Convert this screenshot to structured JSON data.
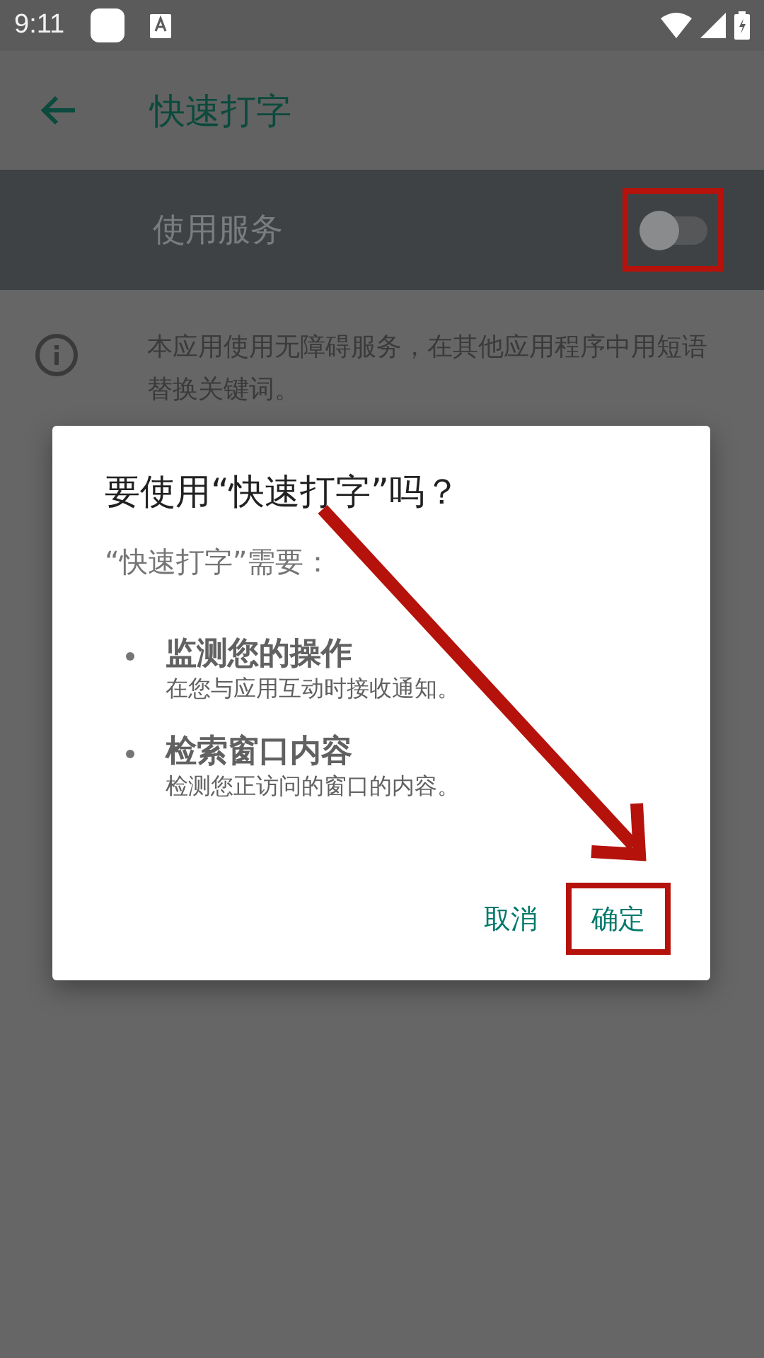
{
  "status_bar": {
    "time": "9:11"
  },
  "toolbar": {
    "title": "快速打字"
  },
  "service": {
    "label": "使用服务",
    "on": false
  },
  "info": {
    "text": "本应用使用无障碍服务，在其他应用程序中用短语替换关键词。"
  },
  "dialog": {
    "title": "要使用“快速打字”吗？",
    "subtitle": "“快速打字”需要：",
    "items": [
      {
        "title": "监测您的操作",
        "description": "在您与应用互动时接收通知。"
      },
      {
        "title": "检索窗口内容",
        "description": "检测您正访问的窗口的内容。"
      }
    ],
    "buttons": [
      {
        "label": "取消",
        "highlighted": false
      },
      {
        "label": "确定",
        "highlighted": true
      }
    ]
  }
}
